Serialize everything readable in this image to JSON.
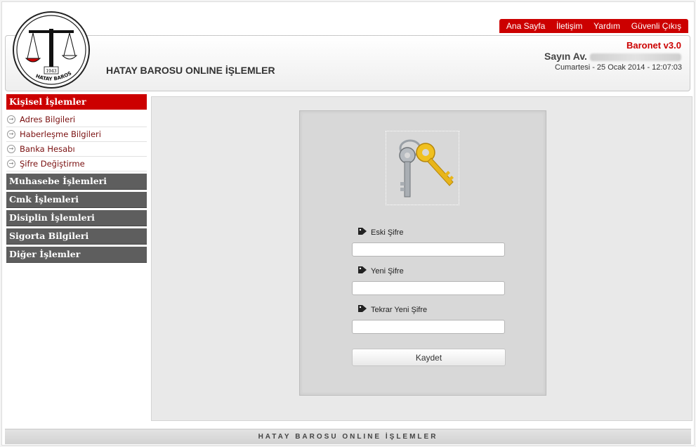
{
  "topnav": {
    "items": [
      "Ana Sayfa",
      "İletişim",
      "Yardım",
      "Güvenli Çıkış"
    ]
  },
  "header": {
    "logo_text": "HATAY BAROSU",
    "logo_year": "1943",
    "site_title": "HATAY BAROSU ONLINE İŞLEMLER",
    "brand": "Baronet v3.0",
    "greeting": "Sayın Av.",
    "datetime": "Cumartesi - 25 Ocak 2014 - 12:07:03"
  },
  "sidebar": {
    "active_section": "Kişisel İşlemler",
    "sub_items": [
      "Adres Bilgileri",
      "Haberleşme Bilgileri",
      "Banka Hesabı",
      "Şifre Değiştirme"
    ],
    "sections": [
      "Muhasebe İşlemleri",
      "Cmk İşlemleri",
      "Disiplin İşlemleri",
      "Sigorta Bilgileri",
      "Diğer İşlemler"
    ]
  },
  "form": {
    "fields": [
      {
        "label": "Eski Şifre",
        "value": ""
      },
      {
        "label": "Yeni Şifre",
        "value": ""
      },
      {
        "label": "Tekrar Yeni Şifre",
        "value": ""
      }
    ],
    "submit_label": "Kaydet"
  },
  "footer": {
    "text": "HATAY BAROSU ONLINE İŞLEMLER"
  },
  "colors": {
    "accent": "#cc0000",
    "menu_grey": "#5e5e5e",
    "link": "#7a1010"
  },
  "icons": {
    "keys": "keys-icon",
    "tag": "tag-icon",
    "arrow": "arrow-circle-icon"
  }
}
